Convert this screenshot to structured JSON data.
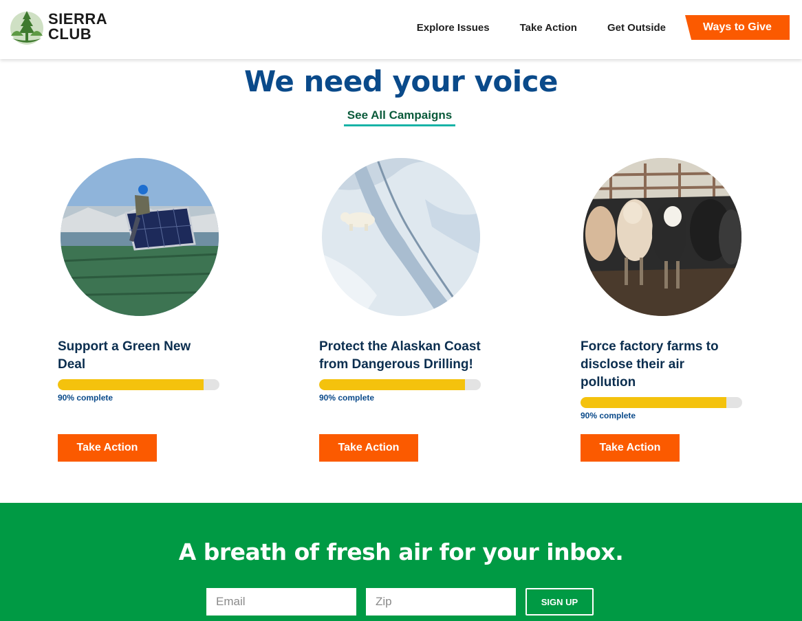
{
  "brand": {
    "line1": "SIERRA",
    "line2": "CLUB",
    "logo": "tree-mountain-logo",
    "color": "#3f7a2f"
  },
  "nav": {
    "items": [
      "Explore Issues",
      "Take Action",
      "Get Outside"
    ],
    "cta": "Ways to Give",
    "cta_color": "#fb5a00"
  },
  "main": {
    "title": "We need your voice",
    "see_all": "See All Campaigns",
    "cards": [
      {
        "title": "Support a Green New Deal",
        "progress": 0.9,
        "progress_label": "90% complete",
        "button": "Take Action",
        "image": "solar-panel-worker-photo"
      },
      {
        "title": "Protect the Alaskan Coast from Dangerous Drilling!",
        "progress": 0.9,
        "progress_label": "90% complete",
        "button": "Take Action",
        "image": "polar-bear-sea-ice-photo"
      },
      {
        "title": "Force factory farms to disclose their air pollution",
        "progress": 0.9,
        "progress_label": "90% complete",
        "button": "Take Action",
        "image": "cattle-feedlot-photo"
      }
    ]
  },
  "newsletter": {
    "title": "A breath of fresh air for your inbox.",
    "email_placeholder": "Email",
    "zip_placeholder": "Zip",
    "signup": "SIGN UP",
    "background": "#009a44"
  },
  "colors": {
    "progress_fill": "#f4c20d",
    "title_blue": "#0a4a8a",
    "underline": "#17b3a6"
  }
}
